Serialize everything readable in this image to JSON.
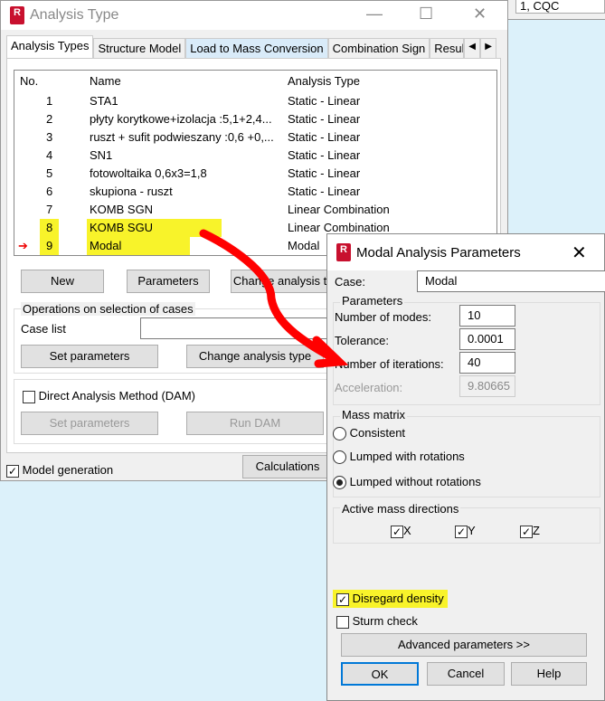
{
  "background": {
    "field": "1, CQC"
  },
  "main": {
    "title": "Analysis Type",
    "logo": "R",
    "tabs": [
      "Analysis Types",
      "Structure Model",
      "Load to Mass Conversion",
      "Combination Sign",
      "Result"
    ],
    "columns": [
      "No.",
      "Name",
      "Analysis Type"
    ],
    "rows": [
      {
        "no": "1",
        "name": "STA1",
        "type": "Static - Linear"
      },
      {
        "no": "2",
        "name": "płyty korytkowe+izolacja :5,1+2,4...",
        "type": "Static - Linear"
      },
      {
        "no": "3",
        "name": "ruszt + sufit podwieszany :0,6 +0,...",
        "type": "Static - Linear"
      },
      {
        "no": "4",
        "name": "SN1",
        "type": "Static - Linear"
      },
      {
        "no": "5",
        "name": "fotowoltaika  0,6x3=1,8",
        "type": "Static - Linear"
      },
      {
        "no": "6",
        "name": "skupiona - ruszt",
        "type": "Static - Linear"
      },
      {
        "no": "7",
        "name": "KOMB SGN",
        "type": "Linear Combination"
      },
      {
        "no": "8",
        "name": "KOMB SGU",
        "type": "Linear Combination"
      },
      {
        "no": "9",
        "name": "Modal",
        "type": "Modal"
      }
    ],
    "new": "New",
    "parameters": "Parameters",
    "change_analysis": "Change analysis type",
    "ops_title": "Operations on selection of cases",
    "case_list": "Case list",
    "set_parameters": "Set parameters",
    "change_type": "Change analysis type",
    "dam": "Direct Analysis Method (DAM)",
    "dam_set": "Set parameters",
    "run_dam": "Run DAM",
    "model_generation": "Model generation",
    "calculations": "Calculations"
  },
  "modal": {
    "title": "Modal Analysis Parameters",
    "case_label": "Case:",
    "case_value": "Modal",
    "params_title": "Parameters",
    "modes_label": "Number of modes:",
    "modes": "10",
    "tol_label": "Tolerance:",
    "tol": "0.0001",
    "iter_label": "Number of iterations:",
    "iter": "40",
    "acc_label": "Acceleration:",
    "acc": "9.80665",
    "mass_title": "Mass matrix",
    "consistent": "Consistent",
    "lumped_rot": "Lumped with rotations",
    "lumped_no_rot": "Lumped without rotations",
    "dir_title": "Active mass directions",
    "x": "X",
    "y": "Y",
    "z": "Z",
    "disregard": "Disregard density",
    "sturm": "Sturm check",
    "advanced": "Advanced parameters >>",
    "ok": "OK",
    "cancel": "Cancel",
    "help": "Help"
  },
  "colors": {
    "highlight": "#f8f32a",
    "arrow": "#ff0000"
  }
}
